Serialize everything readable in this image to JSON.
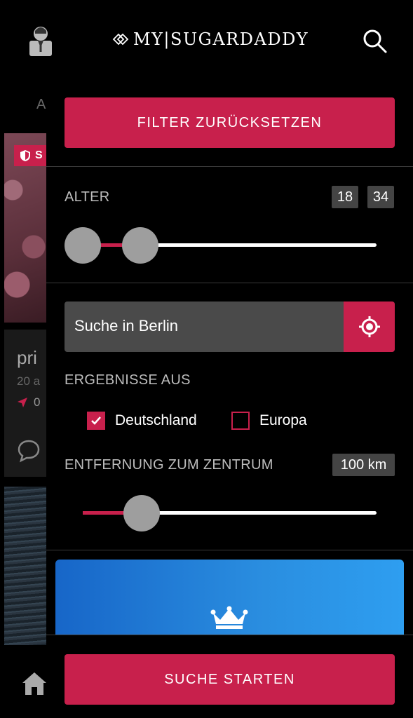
{
  "header": {
    "logo_text": "MY|SUGARDADDY"
  },
  "background_page": {
    "tab_letter": "A",
    "badge_text": "S",
    "profile_name": "pri",
    "profile_age": "20 a",
    "profile_distance": "0"
  },
  "filter": {
    "reset_label": "FILTER ZURÜCKSETZEN",
    "age": {
      "label": "ALTER",
      "min": "18",
      "max": "34"
    },
    "location": {
      "search_text": "Suche in Berlin"
    },
    "results": {
      "label": "ERGEBNISSE AUS",
      "options": [
        {
          "label": "Deutschland",
          "checked": true
        },
        {
          "label": "Europa",
          "checked": false
        }
      ]
    },
    "distance": {
      "label": "ENTFERNUNG ZUM ZENTRUM",
      "value": "100 km"
    },
    "start_label": "SUCHE STARTEN"
  },
  "colors": {
    "accent": "#c8204c",
    "background": "#000000",
    "premium_blue": "#2a8ee0"
  },
  "icons": [
    "profile-icon",
    "search-icon",
    "shield-icon",
    "navigation-arrow-icon",
    "chat-bubble-icon",
    "home-icon",
    "crosshair-icon",
    "checkmark-icon",
    "crown-icon"
  ]
}
